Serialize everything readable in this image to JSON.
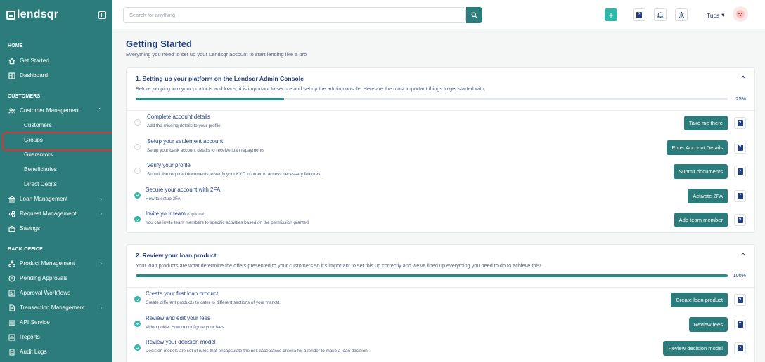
{
  "brand": {
    "name": "lendsqr"
  },
  "topbar": {
    "search_placeholder": "Search for anything",
    "user_name": "Tucs",
    "user_caret": "▾",
    "plus_label": "+"
  },
  "sidebar": {
    "sections": [
      {
        "label": "HOME"
      },
      {
        "label": "CUSTOMERS"
      },
      {
        "label": "BACK OFFICE"
      }
    ],
    "items": [
      {
        "label": "Get Started",
        "icon": "home-icon"
      },
      {
        "label": "Dashboard",
        "icon": "dashboard-icon"
      },
      {
        "label": "Customer Management",
        "icon": "users-icon",
        "chevron": "⌃"
      },
      {
        "label": "Customers"
      },
      {
        "label": "Groups"
      },
      {
        "label": "Guarantors"
      },
      {
        "label": "Beneficiaries"
      },
      {
        "label": "Direct Debits"
      },
      {
        "label": "Loan Management",
        "icon": "bank-icon",
        "chevron": "›"
      },
      {
        "label": "Request Management",
        "icon": "request-icon",
        "chevron": "›"
      },
      {
        "label": "Savings",
        "icon": "savings-icon"
      },
      {
        "label": "Product Management",
        "icon": "product-icon",
        "chevron": "›"
      },
      {
        "label": "Pending Approvals",
        "icon": "clock-icon"
      },
      {
        "label": "Approval Workflows",
        "icon": "workflow-icon"
      },
      {
        "label": "Transaction Management",
        "icon": "transaction-icon",
        "chevron": "›"
      },
      {
        "label": "API Service",
        "icon": "api-icon"
      },
      {
        "label": "Reports",
        "icon": "reports-icon"
      },
      {
        "label": "Audit Logs",
        "icon": "audit-icon"
      }
    ]
  },
  "main": {
    "title": "Getting Started",
    "subtitle": "Everything you need to set up your Lendsqr account to start lending like a pro",
    "cards": [
      {
        "title": "1. Setting up your platform on the Lendsqr Admin Console",
        "desc": "Before jumping into your products and loans, it is important to secure and set up the admin console. Here are the most important things to get started with.",
        "progress": 0.25,
        "progress_label": "25%",
        "caret": "⌃",
        "tasks": [
          {
            "title": "Complete account details",
            "optional": "",
            "desc": "Add the missing details to your profile",
            "done": false,
            "button": "Take me there"
          },
          {
            "title": "Setup your settlement account",
            "optional": "",
            "desc": "Setup your bank account details to receive loan repayments",
            "done": false,
            "button": "Enter Account Details"
          },
          {
            "title": "Verify your profile",
            "optional": "",
            "desc": "Submit the required documents to verify your KYC in order to access necessary features.",
            "done": false,
            "button": "Submit documents"
          },
          {
            "title": "Secure your account with 2FA",
            "optional": "",
            "desc": "How to setup 2FA",
            "done": true,
            "button": "Activate 2FA"
          },
          {
            "title": "Invite your team",
            "optional": "(Optional)",
            "desc": "You can invite team members to specific activities based on the permission granted.",
            "done": true,
            "button": "Add team member"
          }
        ]
      },
      {
        "title": "2. Review your loan product",
        "desc": "Your loan products are what determine the offers presented to your customers so it's important to set this up correctly and we've lined up everything you need to do to achieve this!",
        "progress": 1.0,
        "progress_label": "100%",
        "caret": "⌃",
        "tasks": [
          {
            "title": "Create your first loan product",
            "optional": "",
            "desc": "Create different products to cater to different sections of your market.",
            "done": true,
            "button": "Create loan product"
          },
          {
            "title": "Review and edit your fees",
            "optional": "",
            "desc": "Video guide: How to configure your fees",
            "done": true,
            "button": "Review fees"
          },
          {
            "title": "Review your decision model",
            "optional": "",
            "desc": "Decision models are set of rules that encapsulate the risk acceptance criteria for a lender to make a loan decision.",
            "done": true,
            "button": "Review decision model"
          }
        ]
      }
    ]
  },
  "colors": {
    "sidebar": "#2c7c7b",
    "accent": "#2fb8a7",
    "text": "#213f7d",
    "highlight": "#e0322f"
  }
}
